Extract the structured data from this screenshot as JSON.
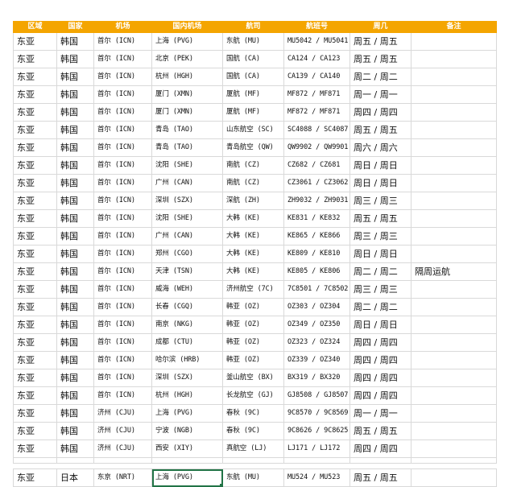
{
  "headers": [
    "区域",
    "国家",
    "机场",
    "国内机场",
    "航司",
    "航班号",
    "周几",
    "备注"
  ],
  "rows": [
    [
      "东亚",
      "韩国",
      "首尔 (ICN)",
      "上海 (PVG)",
      "东航 (MU)",
      "MU5042 / MU5041",
      "周五 / 周五",
      ""
    ],
    [
      "东亚",
      "韩国",
      "首尔 (ICN)",
      "北京 (PEK)",
      "国航 (CA)",
      "CA124 / CA123",
      "周五 / 周五",
      ""
    ],
    [
      "东亚",
      "韩国",
      "首尔 (ICN)",
      "杭州 (HGH)",
      "国航 (CA)",
      "CA139 / CA140",
      "周二 / 周二",
      ""
    ],
    [
      "东亚",
      "韩国",
      "首尔 (ICN)",
      "厦门 (XMN)",
      "厦航 (MF)",
      "MF872 / MF871",
      "周一 / 周一",
      ""
    ],
    [
      "东亚",
      "韩国",
      "首尔 (ICN)",
      "厦门 (XMN)",
      "厦航 (MF)",
      "MF872 / MF871",
      "周四 / 周四",
      ""
    ],
    [
      "东亚",
      "韩国",
      "首尔 (ICN)",
      "青岛 (TAO)",
      "山东航空 (SC)",
      "SC4088 / SC4087",
      "周五 / 周五",
      ""
    ],
    [
      "东亚",
      "韩国",
      "首尔 (ICN)",
      "青岛 (TAO)",
      "青岛航空 (QW)",
      "QW9902 / QW9901",
      "周六 / 周六",
      ""
    ],
    [
      "东亚",
      "韩国",
      "首尔 (ICN)",
      "沈阳 (SHE)",
      "南航 (CZ)",
      "CZ682 / CZ681",
      "周日 / 周日",
      ""
    ],
    [
      "东亚",
      "韩国",
      "首尔 (ICN)",
      "广州 (CAN)",
      "南航 (CZ)",
      "CZ3061 / CZ3062",
      "周日 / 周日",
      ""
    ],
    [
      "东亚",
      "韩国",
      "首尔 (ICN)",
      "深圳 (SZX)",
      "深航 (ZH)",
      "ZH9032 / ZH9031",
      "周三 / 周三",
      ""
    ],
    [
      "东亚",
      "韩国",
      "首尔 (ICN)",
      "沈阳 (SHE)",
      "大韩 (KE)",
      "KE831 / KE832",
      "周五 / 周五",
      ""
    ],
    [
      "东亚",
      "韩国",
      "首尔 (ICN)",
      "广州 (CAN)",
      "大韩 (KE)",
      "KE865 / KE866",
      "周三 / 周三",
      ""
    ],
    [
      "东亚",
      "韩国",
      "首尔 (ICN)",
      "郑州 (CGO)",
      "大韩 (KE)",
      "KE809 / KE810",
      "周日 / 周日",
      ""
    ],
    [
      "东亚",
      "韩国",
      "首尔 (ICN)",
      "天津 (TSN)",
      "大韩 (KE)",
      "KE805 / KE806",
      "周二 / 周二",
      "隔周运航"
    ],
    [
      "东亚",
      "韩国",
      "首尔 (ICN)",
      "威海 (WEH)",
      "济州航空 (7C)",
      "7C8501 / 7C8502",
      "周三 / 周三",
      ""
    ],
    [
      "东亚",
      "韩国",
      "首尔 (ICN)",
      "长春 (CGQ)",
      "韩亚 (OZ)",
      "OZ303 / OZ304",
      "周二 / 周二",
      ""
    ],
    [
      "东亚",
      "韩国",
      "首尔 (ICN)",
      "南京 (NKG)",
      "韩亚 (OZ)",
      "OZ349 / OZ350",
      "周日 / 周日",
      ""
    ],
    [
      "东亚",
      "韩国",
      "首尔 (ICN)",
      "成都 (CTU)",
      "韩亚 (OZ)",
      "OZ323 / OZ324",
      "周四 / 周四",
      ""
    ],
    [
      "东亚",
      "韩国",
      "首尔 (ICN)",
      "哈尔滨 (HRB)",
      "韩亚 (OZ)",
      "OZ339 / OZ340",
      "周四 / 周四",
      ""
    ],
    [
      "东亚",
      "韩国",
      "首尔 (ICN)",
      "深圳 (SZX)",
      "釜山航空 (BX)",
      "BX319 / BX320",
      "周四 / 周四",
      ""
    ],
    [
      "东亚",
      "韩国",
      "首尔 (ICN)",
      "杭州 (HGH)",
      "长龙航空 (GJ)",
      "GJ8508 / GJ8507",
      "周四 / 周四",
      ""
    ],
    [
      "东亚",
      "韩国",
      "济州 (CJU)",
      "上海 (PVG)",
      "春秋 (9C)",
      "9C8570 / 9C8569",
      "周一 / 周一",
      ""
    ],
    [
      "东亚",
      "韩国",
      "济州 (CJU)",
      "宁波 (NGB)",
      "春秋 (9C)",
      "9C8626 / 9C8625",
      "周五 / 周五",
      ""
    ],
    [
      "东亚",
      "韩国",
      "济州 (CJU)",
      "西安 (XIY)",
      "真航空 (LJ)",
      "LJ171 / LJ172",
      "周四 / 周四",
      ""
    ]
  ],
  "last_row": [
    "东亚",
    "日本",
    "东京 (NRT)",
    "上海 (PVG)",
    "东航 (MU)",
    "MU524 / MU523",
    "周五 / 周五",
    ""
  ],
  "colors": {
    "header_bg": "#f4a500",
    "selection": "#217346",
    "grid": "#d9d9d9"
  }
}
